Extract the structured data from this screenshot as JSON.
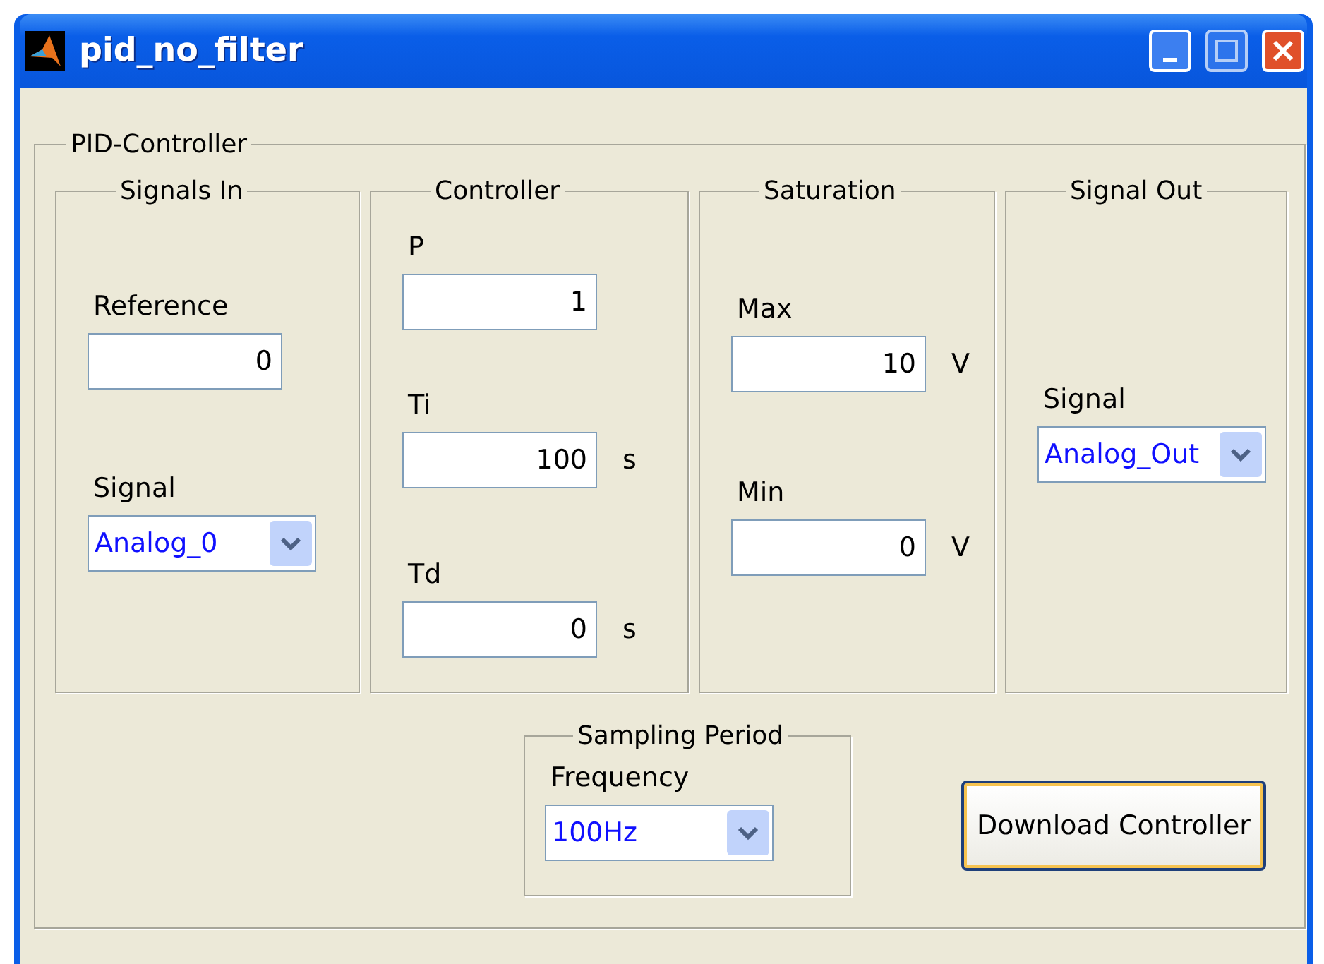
{
  "window": {
    "title": "pid_no_filter"
  },
  "panel": {
    "title": "PID-Controller"
  },
  "groups": [
    {
      "title": "Signals In",
      "fields": [
        {
          "kind": "input",
          "label": "Reference",
          "value": "0"
        },
        {
          "kind": "dropdown",
          "label": "Signal",
          "value": "Analog_0"
        }
      ]
    },
    {
      "title": "Controller",
      "fields": [
        {
          "kind": "input",
          "label": "P",
          "value": "1"
        },
        {
          "kind": "input",
          "label": "Ti",
          "value": "100",
          "unit": "s"
        },
        {
          "kind": "input",
          "label": "Td",
          "value": "0",
          "unit": "s"
        }
      ]
    },
    {
      "title": "Saturation",
      "fields": [
        {
          "kind": "input",
          "label": "Max",
          "value": "10",
          "unit": "V"
        },
        {
          "kind": "input",
          "label": "Min",
          "value": "0",
          "unit": "V"
        }
      ]
    },
    {
      "title": "Signal Out",
      "fields": [
        {
          "kind": "dropdown",
          "label": "Signal",
          "value": "Analog_Out"
        }
      ]
    }
  ],
  "sampling": {
    "title": "Sampling Period",
    "fields": [
      {
        "kind": "dropdown",
        "label": "Frequency",
        "value": "100Hz"
      }
    ]
  },
  "button": {
    "label": "Download Controller"
  }
}
